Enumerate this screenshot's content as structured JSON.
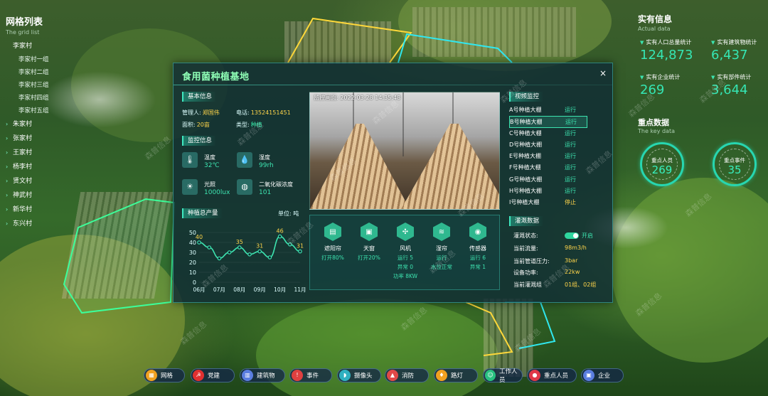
{
  "left_panel": {
    "title": "网格列表",
    "subtitle": "The grid list",
    "villages": [
      {
        "label": "李家村"
      },
      {
        "label": "李家村一组",
        "child": true
      },
      {
        "label": "李家村二组",
        "child": true
      },
      {
        "label": "李家村三组",
        "child": true
      },
      {
        "label": "李家村四组",
        "child": true
      },
      {
        "label": "李家村五组",
        "child": true
      },
      {
        "label": "朱家村"
      },
      {
        "label": "张家村"
      },
      {
        "label": "王家村"
      },
      {
        "label": "杨李村"
      },
      {
        "label": "贤文村"
      },
      {
        "label": "神武村"
      },
      {
        "label": "新华村"
      },
      {
        "label": "东兴村"
      }
    ]
  },
  "right_panel": {
    "title": "实有信息",
    "subtitle": "Actual data",
    "stats": [
      {
        "label": "实有人口总量统计",
        "value": "124,873"
      },
      {
        "label": "实有建筑物统计",
        "value": "6,437"
      },
      {
        "label": "实有企业统计",
        "value": "269"
      },
      {
        "label": "实有部件统计",
        "value": "3,644"
      }
    ],
    "key_title": "重点数据",
    "key_subtitle": "The key data",
    "key_stats": [
      {
        "label": "重点人员",
        "value": "269"
      },
      {
        "label": "重点事件",
        "value": "35"
      }
    ]
  },
  "modal": {
    "title": "食用菌种植基地",
    "close": "×",
    "basic": {
      "heading": "基本信息",
      "manager_label": "管理人:",
      "manager": "郑国伟",
      "phone_label": "电话:",
      "phone": "13524151451",
      "area_label": "面积:",
      "area": "20亩",
      "type_label": "类型:",
      "type": "种植"
    },
    "monitor_info": {
      "heading": "监控信息",
      "items": [
        {
          "label": "温度",
          "value": "32℃",
          "icon": "thermometer-icon"
        },
        {
          "label": "湿度",
          "value": "99rh",
          "icon": "droplet-icon"
        },
        {
          "label": "光照",
          "value": "1000lux",
          "icon": "sun-icon"
        },
        {
          "label": "二氧化碳浓度",
          "value": "101",
          "icon": "co2-icon"
        }
      ]
    },
    "production": {
      "heading": "种植总产量",
      "unit": "单位: 吨"
    },
    "video": {
      "timestamp": "监控画面: 2022-03-28  14:35:48"
    },
    "video_monitor": {
      "heading": "视频监控",
      "items": [
        {
          "name": "A号种植大棚",
          "status": "运行"
        },
        {
          "name": "B号种植大棚",
          "status": "运行",
          "selected": true
        },
        {
          "name": "C号种植大棚",
          "status": "运行"
        },
        {
          "name": "D号种植大棚",
          "status": "运行"
        },
        {
          "name": "E号种植大棚",
          "status": "运行"
        },
        {
          "name": "F号种植大棚",
          "status": "运行"
        },
        {
          "name": "G号种植大棚",
          "status": "运行"
        },
        {
          "name": "H号种植大棚",
          "status": "运行"
        },
        {
          "name": "I号种植大棚",
          "status": "停止"
        }
      ]
    },
    "irrigation": {
      "heading": "灌溉数据",
      "status_label": "灌溉状态:",
      "status_value": "开启",
      "flow_label": "当前流量:",
      "flow_value": "98m3/h",
      "pressure_label": "当前管道压力:",
      "pressure_value": "3bar",
      "power_label": "设备功率:",
      "power_value": "22kw",
      "group_label": "当前灌溉组",
      "group_value": "01组、02组"
    },
    "devices": [
      {
        "name": "遮阳帘",
        "status": [
          "打开80%"
        ],
        "icon": "blind-icon"
      },
      {
        "name": "天窗",
        "status": [
          "打开20%"
        ],
        "icon": "window-icon"
      },
      {
        "name": "风机",
        "status": [
          "运行 5",
          "异常 0",
          "功率 8KW"
        ],
        "icon": "fan-icon"
      },
      {
        "name": "湿帘",
        "status": [
          "运行",
          "水位正常"
        ],
        "icon": "wet-curtain-icon"
      },
      {
        "name": "传感器",
        "status": [
          "运行 6",
          "异常 1"
        ],
        "icon": "sensor-icon"
      }
    ]
  },
  "chart_data": {
    "type": "line",
    "title": "种植总产量",
    "ylabel": "单位: 吨",
    "categories": [
      "06月",
      "07月",
      "08月",
      "09月",
      "10月",
      "11月"
    ],
    "x_ticks": [
      "06月",
      "07月",
      "08月",
      "09月",
      "10月",
      "11月"
    ],
    "points": [
      {
        "x": "06月",
        "y": 40
      },
      {
        "x": null,
        "y": 35
      },
      {
        "x": "07月",
        "y": 24
      },
      {
        "x": null,
        "y": 30
      },
      {
        "x": "08月",
        "y": 35
      },
      {
        "x": null,
        "y": 28
      },
      {
        "x": "09月",
        "y": 31
      },
      {
        "x": null,
        "y": 25
      },
      {
        "x": "10月",
        "y": 46
      },
      {
        "x": null,
        "y": 38
      },
      {
        "x": "11月",
        "y": 31
      }
    ],
    "labels": [
      {
        "x": "06月",
        "y": 40,
        "text": "40"
      },
      {
        "x": "08月",
        "y": 35,
        "text": "35"
      },
      {
        "x": "09月",
        "y": 31,
        "text": "31"
      },
      {
        "x": "10月",
        "y": 46,
        "text": "46"
      },
      {
        "x": "11月",
        "y": 31,
        "text": "31"
      }
    ],
    "y_ticks": [
      0,
      10,
      20,
      30,
      40,
      50
    ],
    "ylim": [
      0,
      50
    ],
    "color": "#3de4b0"
  },
  "watermark": "森普信息",
  "bottom_bar": [
    {
      "label": "网格",
      "color": "#f0a020",
      "icon": "grid-icon"
    },
    {
      "label": "党建",
      "color": "#e03030",
      "icon": "party-icon"
    },
    {
      "label": "建筑物",
      "color": "#5a7de0",
      "icon": "building-icon"
    },
    {
      "label": "事件",
      "color": "#e04040",
      "icon": "event-icon"
    },
    {
      "label": "摄像头",
      "color": "#2fb0c0",
      "icon": "camera-icon"
    },
    {
      "label": "消防",
      "color": "#e04848",
      "icon": "fire-icon"
    },
    {
      "label": "路灯",
      "color": "#f0a020",
      "icon": "lamp-icon"
    },
    {
      "label": "工作人员",
      "color": "#28c080",
      "icon": "staff-icon"
    },
    {
      "label": "重点人员",
      "color": "#e03848",
      "icon": "key-person-icon"
    },
    {
      "label": "企业",
      "color": "#5a7de0",
      "icon": "company-icon"
    }
  ]
}
